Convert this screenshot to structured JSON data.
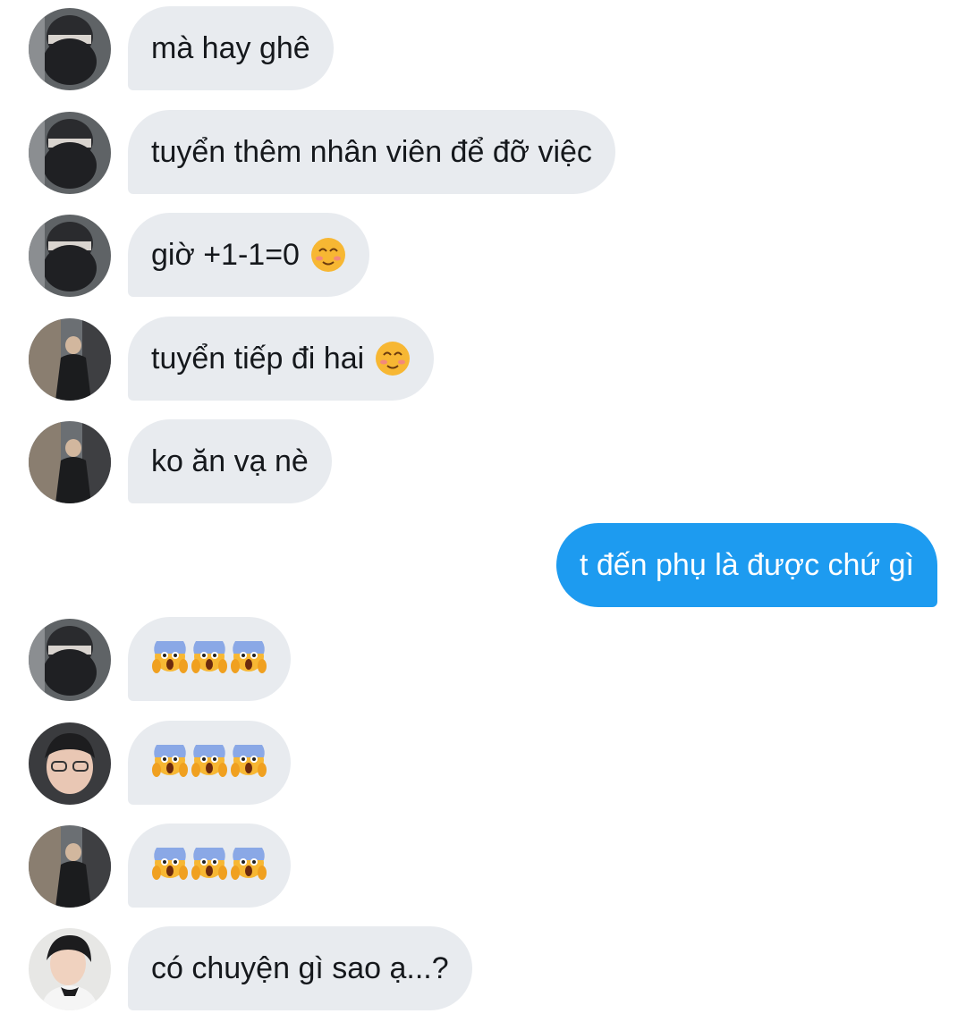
{
  "messages": [
    {
      "text": "mà hay ghê",
      "emoji": "",
      "sender": "user-1",
      "direction": "incoming"
    },
    {
      "text": "tuyển thêm nhân viên để đỡ việc",
      "emoji": "",
      "sender": "user-1",
      "direction": "incoming"
    },
    {
      "text": "giờ +1-1=0",
      "emoji": "smiling-face-icon",
      "sender": "user-1",
      "direction": "incoming"
    },
    {
      "text": "tuyển tiếp đi hai",
      "emoji": "smiling-face-icon",
      "sender": "user-2",
      "direction": "incoming"
    },
    {
      "text": "ko ăn vạ nè",
      "emoji": "",
      "sender": "user-2",
      "direction": "incoming"
    },
    {
      "text": "t đến phụ là được chứ gì",
      "emoji": "",
      "sender": "me",
      "direction": "outgoing"
    },
    {
      "text": "",
      "emoji": "screaming-face-icon x3",
      "sender": "user-1",
      "direction": "incoming"
    },
    {
      "text": "",
      "emoji": "screaming-face-icon x3",
      "sender": "user-3",
      "direction": "incoming"
    },
    {
      "text": "",
      "emoji": "screaming-face-icon x3",
      "sender": "user-2",
      "direction": "incoming"
    },
    {
      "text": "có chuyện gì sao ạ...?",
      "emoji": "",
      "sender": "user-4",
      "direction": "incoming"
    }
  ],
  "colors": {
    "incoming_bubble": "#e8ebef",
    "outgoing_bubble": "#1d9bf0",
    "incoming_text": "#15181c",
    "outgoing_text": "#ffffff"
  }
}
